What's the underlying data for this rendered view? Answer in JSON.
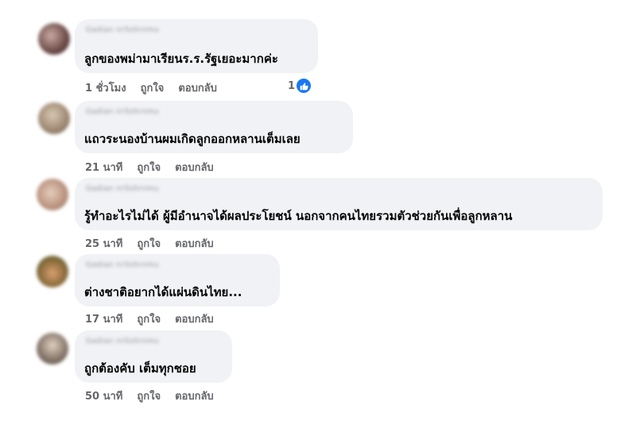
{
  "comments": [
    {
      "author": "Gadian nrSshrnmu",
      "text": "ลูกของพม่ามาเรียนร.ร.รัฐเยอะมากค่ะ",
      "time": "1 ชั่วโมง",
      "like_label": "ถูกใจ",
      "reply_label": "ตอบกลับ",
      "reaction_count": "1",
      "avatar_color": "#7d5a55"
    },
    {
      "author": "Gadian nrSshrnmu",
      "text": "แถวระนองบ้านผมเกิดลูกออกหลานเต็มเลย",
      "time": "21 นาที",
      "like_label": "ถูกใจ",
      "reply_label": "ตอบกลับ",
      "avatar_color": "#a08c78"
    },
    {
      "author": "Gadian nrSshrnmu",
      "text": "รู้ทำอะไรไม่ได้ ผู้มีอำนาจได้ผลประโยชน์ นอกจากคนไทยรวมตัวช่วยกันเพื่อลูกหลาน",
      "time": "25 นาที",
      "like_label": "ถูกใจ",
      "reply_label": "ตอบกลับ",
      "avatar_color": "#b89a88"
    },
    {
      "author": "Gadian nrSshrnmu",
      "text": "ต่างชาติอยากได้แผ่นดินไทย...",
      "time": "17 นาที",
      "like_label": "ถูกใจ",
      "reply_label": "ตอบกลับ",
      "avatar_color": "#8a6a3a"
    },
    {
      "author": "Gadian nrSshrnmu",
      "text": "ถูกต้องคับ เต็มทุกชอย",
      "time": "50 นาที",
      "like_label": "ถูกใจ",
      "reply_label": "ตอบกลับ",
      "avatar_color": "#8a7a6e"
    }
  ],
  "colors": {
    "like_badge": "#1877f2",
    "bubble": "#f0f2f5",
    "action_text": "#65676b"
  }
}
